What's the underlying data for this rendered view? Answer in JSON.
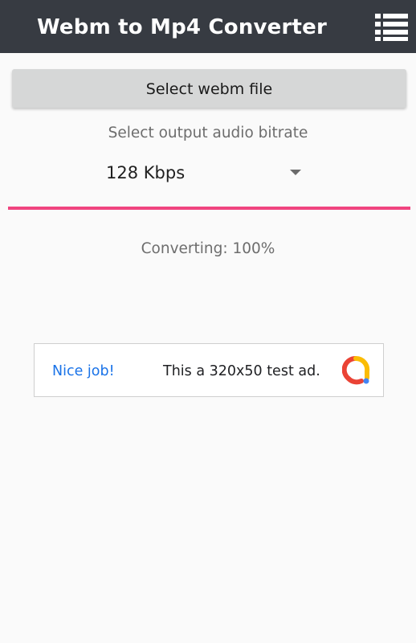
{
  "appbar": {
    "title": "Webm to Mp4 Converter",
    "background": "#373b42",
    "menu_icon": "menu-list-icon"
  },
  "main": {
    "select_button_label": "Select webm file",
    "bitrate_label": "Select output audio bitrate",
    "bitrate_selected": "128 Kbps",
    "accent_color": "#f0447f",
    "status": "Converting: 100%",
    "progress_percent": 100
  },
  "ad": {
    "headline": "Nice job!",
    "text": "This a 320x50 test ad.",
    "logo_icon": "ad-logo-icon"
  }
}
